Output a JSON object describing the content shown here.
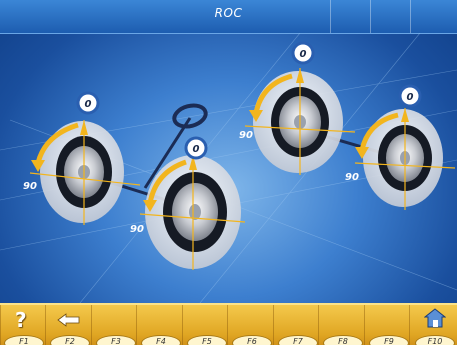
{
  "header": {
    "title": "ROC"
  },
  "wheels": [
    {
      "id": "front-left",
      "top_value": "0",
      "side_value": "90"
    },
    {
      "id": "front-right",
      "top_value": "0",
      "side_value": "90"
    },
    {
      "id": "rear-left",
      "top_value": "0",
      "side_value": "90"
    },
    {
      "id": "rear-right",
      "top_value": "0",
      "side_value": "90"
    }
  ],
  "toolbar": {
    "help_icon": "?",
    "back_icon": "arrow-left-icon",
    "keys": [
      "F1",
      "F2",
      "F3",
      "F4",
      "F5",
      "F6",
      "F7",
      "F8",
      "F9",
      "F10"
    ],
    "home_icon": "home-icon"
  },
  "colors": {
    "accent": "#f2b51e",
    "background": "#2a6ac2",
    "toolbar": "#e8b43a"
  }
}
